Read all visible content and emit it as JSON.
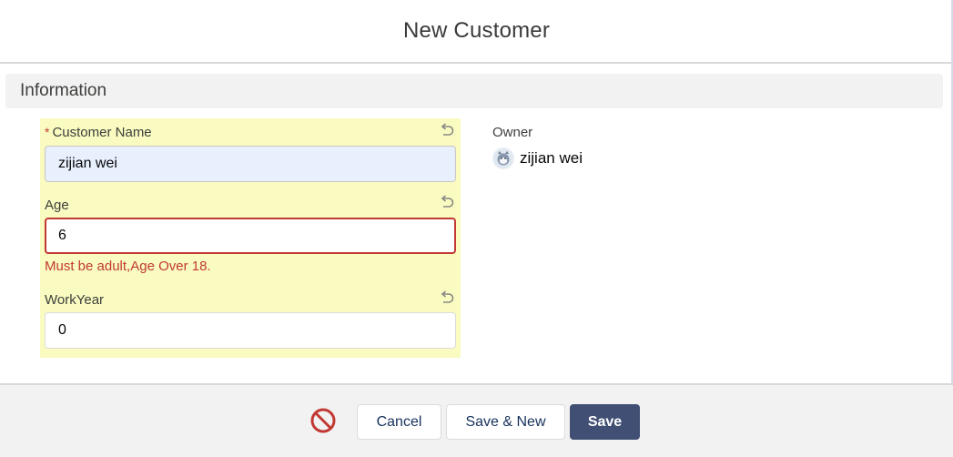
{
  "modal": {
    "title": "New Customer"
  },
  "section": {
    "title": "Information"
  },
  "fields": {
    "customer_name": {
      "required_mark": "*",
      "label": "Customer Name",
      "value": "zijian wei"
    },
    "age": {
      "label": "Age",
      "value": "6",
      "error": "Must be adult,Age Over 18."
    },
    "work_year": {
      "label": "WorkYear",
      "value": "0"
    }
  },
  "owner": {
    "label": "Owner",
    "name": "zijian wei"
  },
  "footer": {
    "cancel_label": "Cancel",
    "save_new_label": "Save & New",
    "save_label": "Save"
  },
  "colors": {
    "edited_highlight": "#f9fbc0",
    "error": "#c23934",
    "brand_button": "#404f73"
  },
  "icons": [
    "undo-icon",
    "user-avatar-icon",
    "error-ban-icon"
  ]
}
